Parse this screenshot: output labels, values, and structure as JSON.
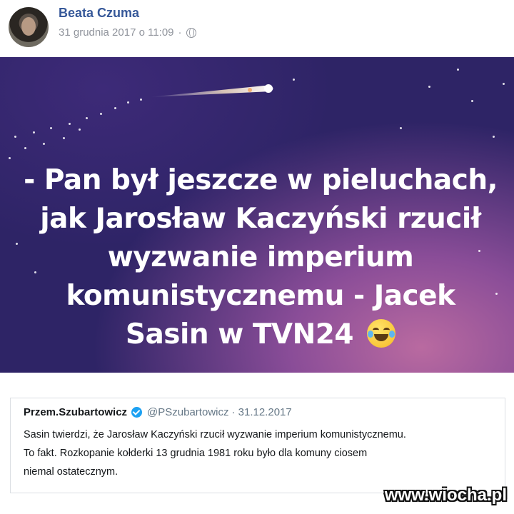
{
  "post": {
    "author": "Beata Czuma",
    "timestamp": "31 grudnia 2017 o 11:09",
    "privacy_icon": "globe-icon"
  },
  "image": {
    "quote_lines": [
      "- Pan był jeszcze w pieluchach,",
      "jak Jarosław Kaczyński rzucił",
      "wyzwanie imperium",
      "komunistycznemu - Jacek",
      "Sasin w TVN24"
    ],
    "emoji": "face-with-tears-of-joy"
  },
  "tweet": {
    "name": "Przem.Szubartowicz",
    "handle": "@PSzubartowicz",
    "date": "· 31.12.2017",
    "lines": [
      "Sasin twierdzi, że Jarosław Kaczyński rzucił wyzwanie imperium komunistycznemu.",
      "To fakt. Rozkopanie kołderki 13 grudnia 1981 roku było dla komuny ciosem",
      "niemal ostatecznym."
    ]
  },
  "watermark": "www.wiocha.pl",
  "colors": {
    "author": "#365899",
    "meta": "#90949c",
    "verified": "#1da1f2"
  }
}
